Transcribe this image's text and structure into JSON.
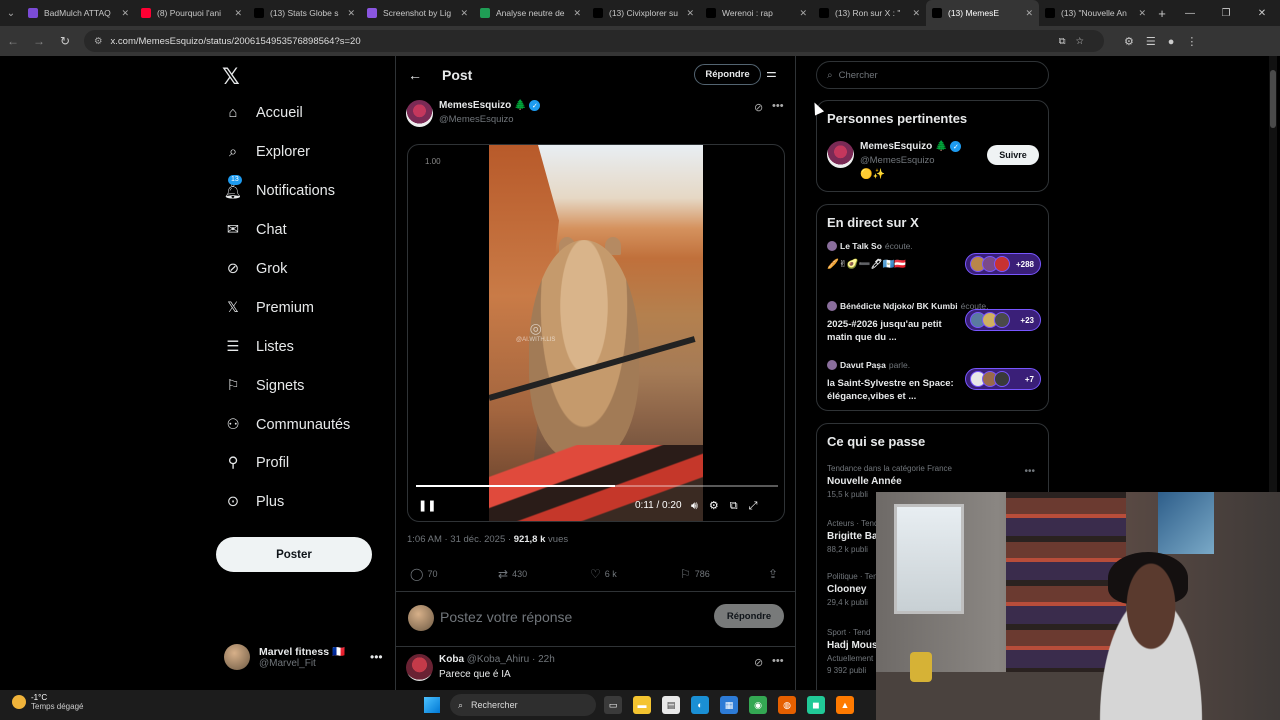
{
  "browser": {
    "tabs": [
      {
        "title": "BadMulch ATTAQ",
        "color": "#7b4bd6",
        "active": false
      },
      {
        "title": "(8) Pourquoi l'ani",
        "color": "#ff0033",
        "active": false
      },
      {
        "title": "(13) Stats Globe s",
        "color": "#000000",
        "active": false
      },
      {
        "title": "Screenshot by Lig",
        "color": "#8a56e0",
        "active": false
      },
      {
        "title": "Analyse neutre de",
        "color": "#1f9d55",
        "active": false
      },
      {
        "title": "(13) Civixplorer su",
        "color": "#000000",
        "active": false
      },
      {
        "title": "Werenoi : rap",
        "color": "#000000",
        "active": false
      },
      {
        "title": "(13) Ron sur X : \"",
        "color": "#000000",
        "active": false
      },
      {
        "title": "(13) MemesE",
        "color": "#000000",
        "active": true
      },
      {
        "title": "(13) \"Nouvelle An",
        "color": "#000000",
        "active": false
      }
    ],
    "url": "x.com/MemesEsquizo/status/2006154953576898564?s=20"
  },
  "nav": {
    "items": [
      {
        "label": "Accueil",
        "icon": "home-icon",
        "glyph": "⌂"
      },
      {
        "label": "Explorer",
        "icon": "search-icon",
        "glyph": "⌕"
      },
      {
        "label": "Notifications",
        "icon": "bell-icon",
        "glyph": "🔔︎",
        "badge": "13"
      },
      {
        "label": "Chat",
        "icon": "mail-icon",
        "glyph": "✉"
      },
      {
        "label": "Grok",
        "icon": "grok-icon",
        "glyph": "⊘"
      },
      {
        "label": "Premium",
        "icon": "x-logo-icon",
        "glyph": "𝕏"
      },
      {
        "label": "Listes",
        "icon": "list-icon",
        "glyph": "☰"
      },
      {
        "label": "Signets",
        "icon": "bookmark-icon",
        "glyph": "⚐"
      },
      {
        "label": "Communautés",
        "icon": "communities-icon",
        "glyph": "⚇"
      },
      {
        "label": "Profil",
        "icon": "person-icon",
        "glyph": "⚲"
      },
      {
        "label": "Plus",
        "icon": "more-circle-icon",
        "glyph": "⊙"
      }
    ],
    "post_button": "Poster",
    "account": {
      "name": "Marvel fitness 🇫🇷",
      "handle": "@Marvel_Fit"
    }
  },
  "post": {
    "header_title": "Post",
    "reply_button": "Répondre",
    "author": {
      "name": "MemesEsquizo 🌲",
      "handle": "@MemesEsquizo"
    },
    "video": {
      "speed": "1.00",
      "time": "0:11 / 0:20",
      "progress": 0.55,
      "watermark": "@AI.WITH.LIS"
    },
    "timestamp": "1:06 AM · 31 déc. 2025 · ",
    "views": "921,8 k",
    "views_label": " vues",
    "stats": {
      "replies": "70",
      "reposts": "430",
      "likes": "6 k",
      "bookmarks": "786"
    },
    "compose_placeholder": "Postez votre réponse",
    "compose_button": "Répondre",
    "reply": {
      "name": "Koba",
      "handle": "@Koba_Ahiru",
      "time": "· 22h",
      "text": "Parece que é IA"
    }
  },
  "right": {
    "search_placeholder": "Chercher",
    "relevant": {
      "title": "Personnes pertinentes",
      "name": "MemesEsquizo 🌲",
      "handle": "@MemesEsquizo",
      "bio": "🟡✨",
      "follow": "Suivre"
    },
    "live": {
      "title": "En direct sur X",
      "items": [
        {
          "host": "Le Talk So",
          "action": "écoute.",
          "title": "🥖✌🥑➖🖊🇬🇹🇦🇹",
          "count": "+288"
        },
        {
          "host": "Bénédicte Ndjoko/ BK Kumbi",
          "action": "écoute.",
          "title": "2025-#2026 jusqu'au petit matin que du ...",
          "count": "+23"
        },
        {
          "host": "Davut Paşa",
          "action": "parle.",
          "title": "la Saint-Sylvestre en Space: élégance,vibes et ...",
          "count": "+7"
        }
      ]
    },
    "trends": {
      "title": "Ce qui se passe",
      "items": [
        {
          "category": "Tendance dans la catégorie France",
          "name": "Nouvelle Année",
          "count": "15,5 k publi"
        },
        {
          "category": "Acteurs · Tend",
          "name": "Brigitte Ba",
          "count": "88,2 k publi"
        },
        {
          "category": "Politique · Tend",
          "name": "Clooney",
          "count": "29,4 k publi"
        },
        {
          "category": "Sport · Tend",
          "name": "Hadj Mous",
          "count": "Actuellement",
          "extra": "9 392 publi"
        }
      ]
    }
  },
  "taskbar": {
    "temp": "-1°C",
    "weather": "Temps dégagé",
    "search": "Rechercher"
  }
}
